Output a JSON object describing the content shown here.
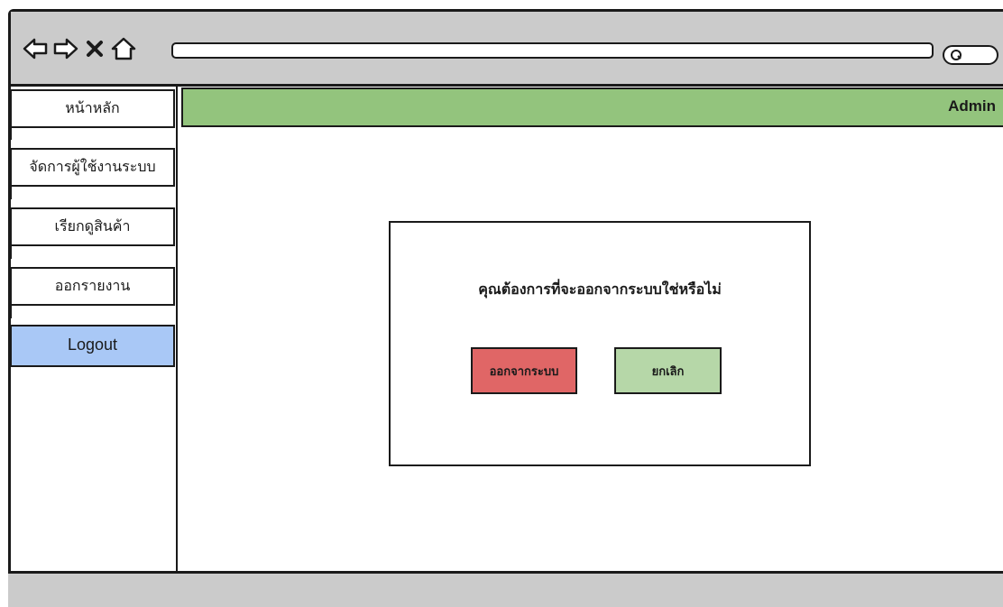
{
  "browser": {
    "icons": [
      "back-arrow-icon",
      "forward-arrow-icon",
      "close-icon",
      "home-icon",
      "search-icon"
    ],
    "url": ""
  },
  "sidebar": {
    "items": [
      {
        "label": "หน้าหลัก"
      },
      {
        "label": "จัดการผู้ใช้งานระบบ"
      },
      {
        "label": "เรียกดูสินค้า"
      },
      {
        "label": "ออกรายงาน"
      },
      {
        "label": "Logout"
      }
    ]
  },
  "header": {
    "user": "Admin"
  },
  "dialog": {
    "message": "คุณต้องการที่จะออกจากระบบใช่หรือไม่",
    "confirm_label": "ออกจากระบบ",
    "cancel_label": "ยกเลิก"
  },
  "colors": {
    "header": "#93c47d",
    "logout_item": "#a9c8f6",
    "confirm_button": "#e06666",
    "cancel_button": "#b6d7a8",
    "chrome": "#cbcbcb"
  }
}
